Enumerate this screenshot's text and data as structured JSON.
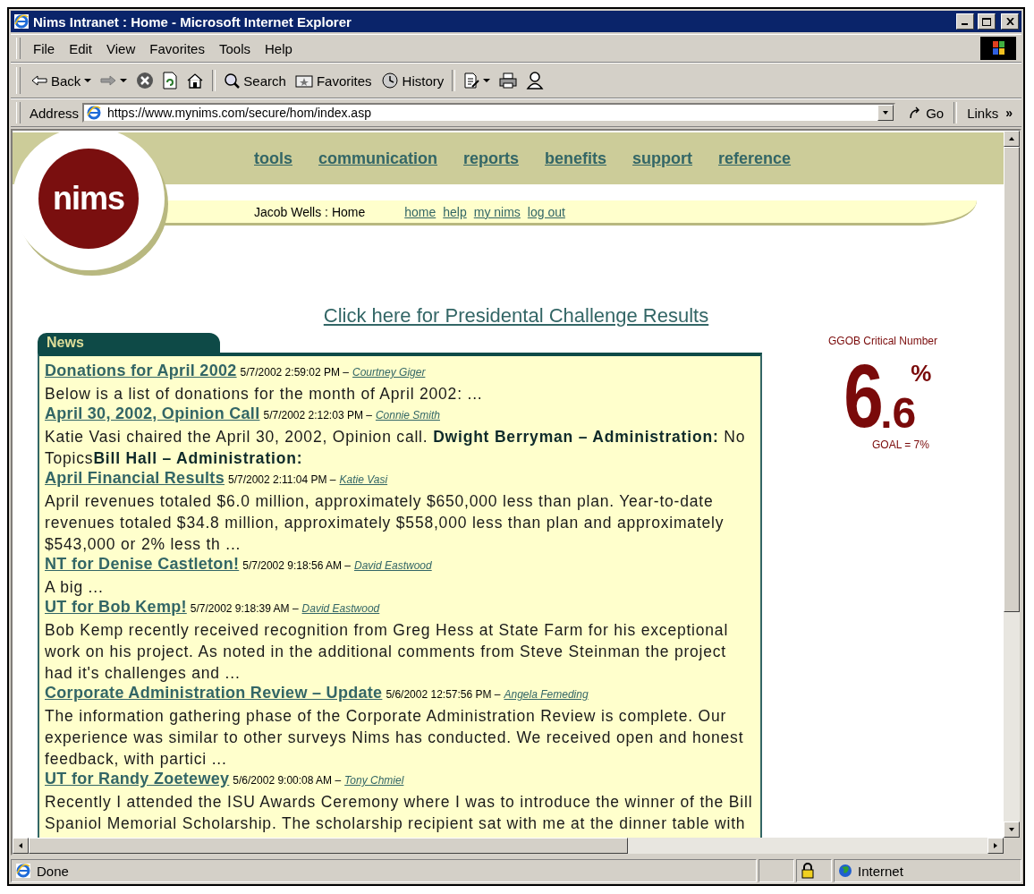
{
  "window": {
    "title": "Nims Intranet : Home - Microsoft Internet Explorer"
  },
  "menu": [
    "File",
    "Edit",
    "View",
    "Favorites",
    "Tools",
    "Help"
  ],
  "toolbar": [
    {
      "kind": "back",
      "label": "Back",
      "dropdown": true
    },
    {
      "kind": "forward",
      "dropdown": true
    },
    {
      "kind": "stop"
    },
    {
      "kind": "refresh"
    },
    {
      "kind": "home"
    },
    {
      "kind": "separator"
    },
    {
      "kind": "search",
      "label": "Search"
    },
    {
      "kind": "favorites",
      "label": "Favorites"
    },
    {
      "kind": "history",
      "label": "History"
    },
    {
      "kind": "separator"
    },
    {
      "kind": "edit",
      "dropdown": true
    },
    {
      "kind": "print"
    },
    {
      "kind": "messenger"
    }
  ],
  "address": {
    "label": "Address",
    "value": "https://www.mynims.com/secure/hom/index.asp",
    "go": "Go",
    "links": "Links",
    "more": "»"
  },
  "site": {
    "logo": "nims",
    "nav": [
      "tools",
      "communication",
      "reports",
      "benefits",
      "support",
      "reference"
    ],
    "user": "Jacob Wells : Home",
    "sublinks": [
      "home",
      "help",
      "my nims",
      "log out"
    ],
    "headline": "Click here for Presidental Challenge Results"
  },
  "news": {
    "title": "News",
    "items": [
      {
        "title": "Donations for April 2002",
        "date": "5/7/2002 2:59:02 PM –",
        "author": "Courtney Giger",
        "body": "Below is a list of donations for the month of April 2002: ..."
      },
      {
        "title": "April 30, 2002, Opinion Call",
        "date": "5/7/2002 2:12:03 PM –",
        "author": "Connie Smith",
        "body": "Katie Vasi chaired the April 30, 2002, Opinion call. **Dwight Berryman – Administration:** No Topics**Bill Hall – Administration:**"
      },
      {
        "title": "April Financial Results",
        "date": "5/7/2002 2:11:04 PM –",
        "author": "Katie Vasi",
        "body": "April revenues totaled $6.0 million, approximately $650,000 less than plan. Year-to-date revenues totaled $34.8 million, approximately $558,000 less than plan and approximately $543,000 or 2% less th ..."
      },
      {
        "title": "NT for Denise Castleton!",
        "date": "5/7/2002 9:18:56 AM –",
        "author": "David Eastwood",
        "body": "A big ..."
      },
      {
        "title": "UT for Bob Kemp!",
        "date": "5/7/2002 9:18:39 AM –",
        "author": "David Eastwood",
        "body": "Bob Kemp recently received recognition from Greg Hess at State Farm for his exceptional work on his project. As noted in the additional comments from Steve Steinman the project had it's challenges and ..."
      },
      {
        "title": "Corporate Administration Review – Update",
        "date": "5/6/2002 12:57:56 PM –",
        "author": "Angela Femeding",
        "body": "The information gathering phase of the Corporate Administration Review is complete. Our experience was similar to other surveys Nims has conducted. We received open and honest feedback, with partici ..."
      },
      {
        "title": "UT for Randy Zoetewey",
        "date": "5/6/2002 9:00:08 AM –",
        "author": "Tony Chmiel",
        "body": "Recently I attended the ISU Awards Ceremony where I was to introduce the winner of the Bill Spaniol Memorial Scholarship. The scholarship recipient sat with me at the dinner table with"
      }
    ]
  },
  "critical": {
    "title": "GGOB Critical Number",
    "whole": "6",
    "decimal": ".6",
    "unit": "%",
    "goal": "GOAL = 7%"
  },
  "status": {
    "text": "Done",
    "zone": "Internet"
  }
}
